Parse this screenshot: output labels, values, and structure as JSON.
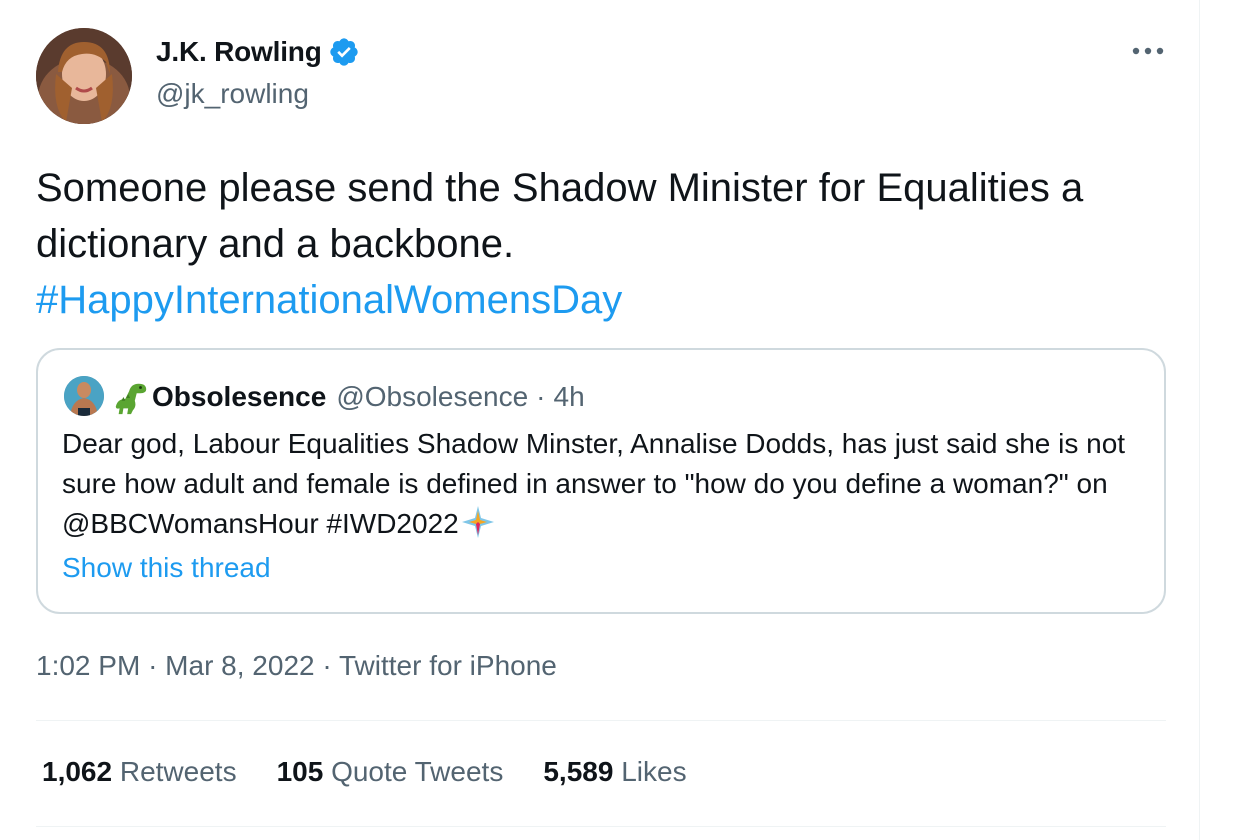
{
  "author": {
    "name": "J.K. Rowling",
    "handle": "@jk_rowling"
  },
  "tweet": {
    "text": "Someone please send the Shadow Minister for Equalities a dictionary and a backbone.",
    "hashtag": "#HappyInternationalWomensDay"
  },
  "quote": {
    "name": "Obsolesence",
    "handle": "@Obsolesence",
    "separator": "·",
    "time": "4h",
    "text": "Dear god, Labour Equalities Shadow Minster, Annalise Dodds, has just said she is not sure how adult and female is defined in answer to \"how do you define a woman?\" on @BBCWomansHour #IWD2022",
    "show_thread": "Show this thread"
  },
  "meta": {
    "time": "1:02 PM",
    "separator": "·",
    "date": "Mar 8, 2022",
    "source": "Twitter for iPhone"
  },
  "stats": [
    {
      "count": "1,062",
      "label": "Retweets"
    },
    {
      "count": "105",
      "label": "Quote Tweets"
    },
    {
      "count": "5,589",
      "label": "Likes"
    }
  ],
  "colors": {
    "accent": "#1d9bf0",
    "secondary_text": "#536471",
    "border": "#cfd9de"
  }
}
